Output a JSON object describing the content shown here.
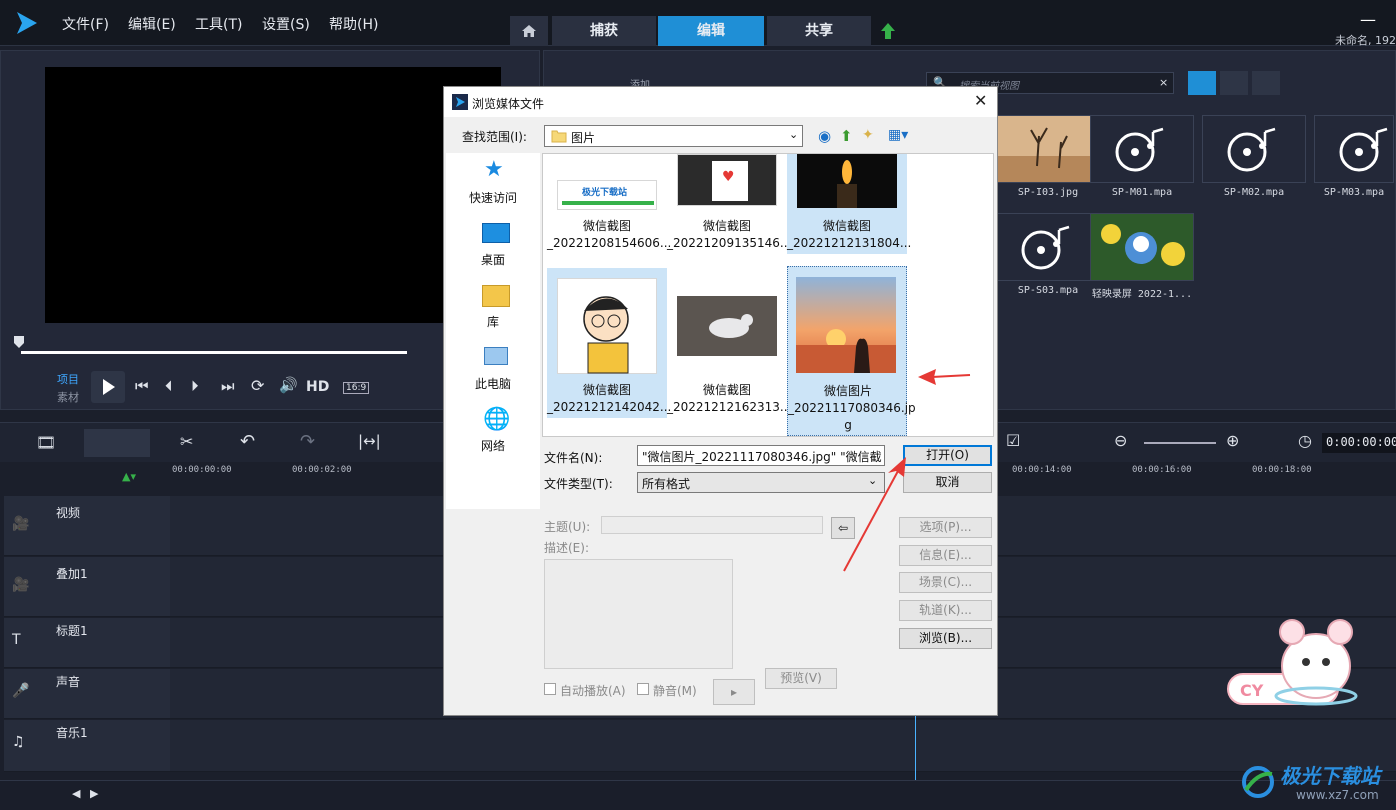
{
  "menubar": {
    "items": [
      "文件(F)",
      "编辑(E)",
      "工具(T)",
      "设置(S)",
      "帮助(H)"
    ],
    "tabs": [
      "捕获",
      "编辑",
      "共享"
    ],
    "active_tab": "编辑",
    "window_title": "未命名, 192"
  },
  "preview": {
    "mode_project": "项目",
    "mode_clip": "素材",
    "hd_label": "HD",
    "aspect_label": "16:9"
  },
  "library": {
    "add_label": "添加",
    "search_placeholder": "搜索当前视图",
    "thumbnails": [
      "SP-I03.jpg",
      "SP-M01.mpa",
      "SP-M02.mpa",
      "SP-M03.mpa",
      "SP-S03.mpa",
      "轻映录屏 2022-1..."
    ]
  },
  "timeline": {
    "timecode": "0:00:00:00",
    "ruler": [
      "00:00:00:00",
      "00:00:02:00",
      "00:00:14:00",
      "00:00:16:00",
      "00:00:18:00"
    ],
    "tracks": [
      "视频",
      "叠加1",
      "标题1",
      "声音",
      "音乐1"
    ]
  },
  "dialog": {
    "title": "浏览媒体文件",
    "lookin_label": "查找范围(I):",
    "lookin_value": "图片",
    "places": [
      "快速访问",
      "桌面",
      "库",
      "此电脑",
      "网络"
    ],
    "files": [
      {
        "line1": "微信截图",
        "line2": "_20221208154606..."
      },
      {
        "line1": "微信截图",
        "line2": "_20221209135146..."
      },
      {
        "line1": "微信截图",
        "line2": "_20221212131804..."
      },
      {
        "line1": "微信截图",
        "line2": "_20221212142042..."
      },
      {
        "line1": "微信截图",
        "line2": "_20221212162313..."
      },
      {
        "line1": "微信图片",
        "line2": "_20221117080346.jp",
        "line3": "g"
      }
    ],
    "watermark_text": "极光下载站",
    "filename_label": "文件名(N):",
    "filename_value": "\"微信图片_20221117080346.jpg\" \"微信截",
    "filetype_label": "文件类型(T):",
    "filetype_value": "所有格式",
    "open_button": "打开(O)",
    "cancel_button": "取消",
    "subject_label": "主题(U):",
    "description_label": "描述(E):",
    "options_button": "选项(P)...",
    "info_button": "信息(E)...",
    "scene_button": "场景(C)...",
    "track_button": "轨道(K)...",
    "browse_button": "浏览(B)...",
    "autoplay_label": "自动播放(A)",
    "mute_label": "静音(M)",
    "preview_button": "预览(V)"
  },
  "branding": {
    "site_name": "极光下载站",
    "site_url": "www.xz7.com"
  },
  "colors": {
    "accent": "#1f8fd6",
    "arrow_red": "#e53935"
  }
}
